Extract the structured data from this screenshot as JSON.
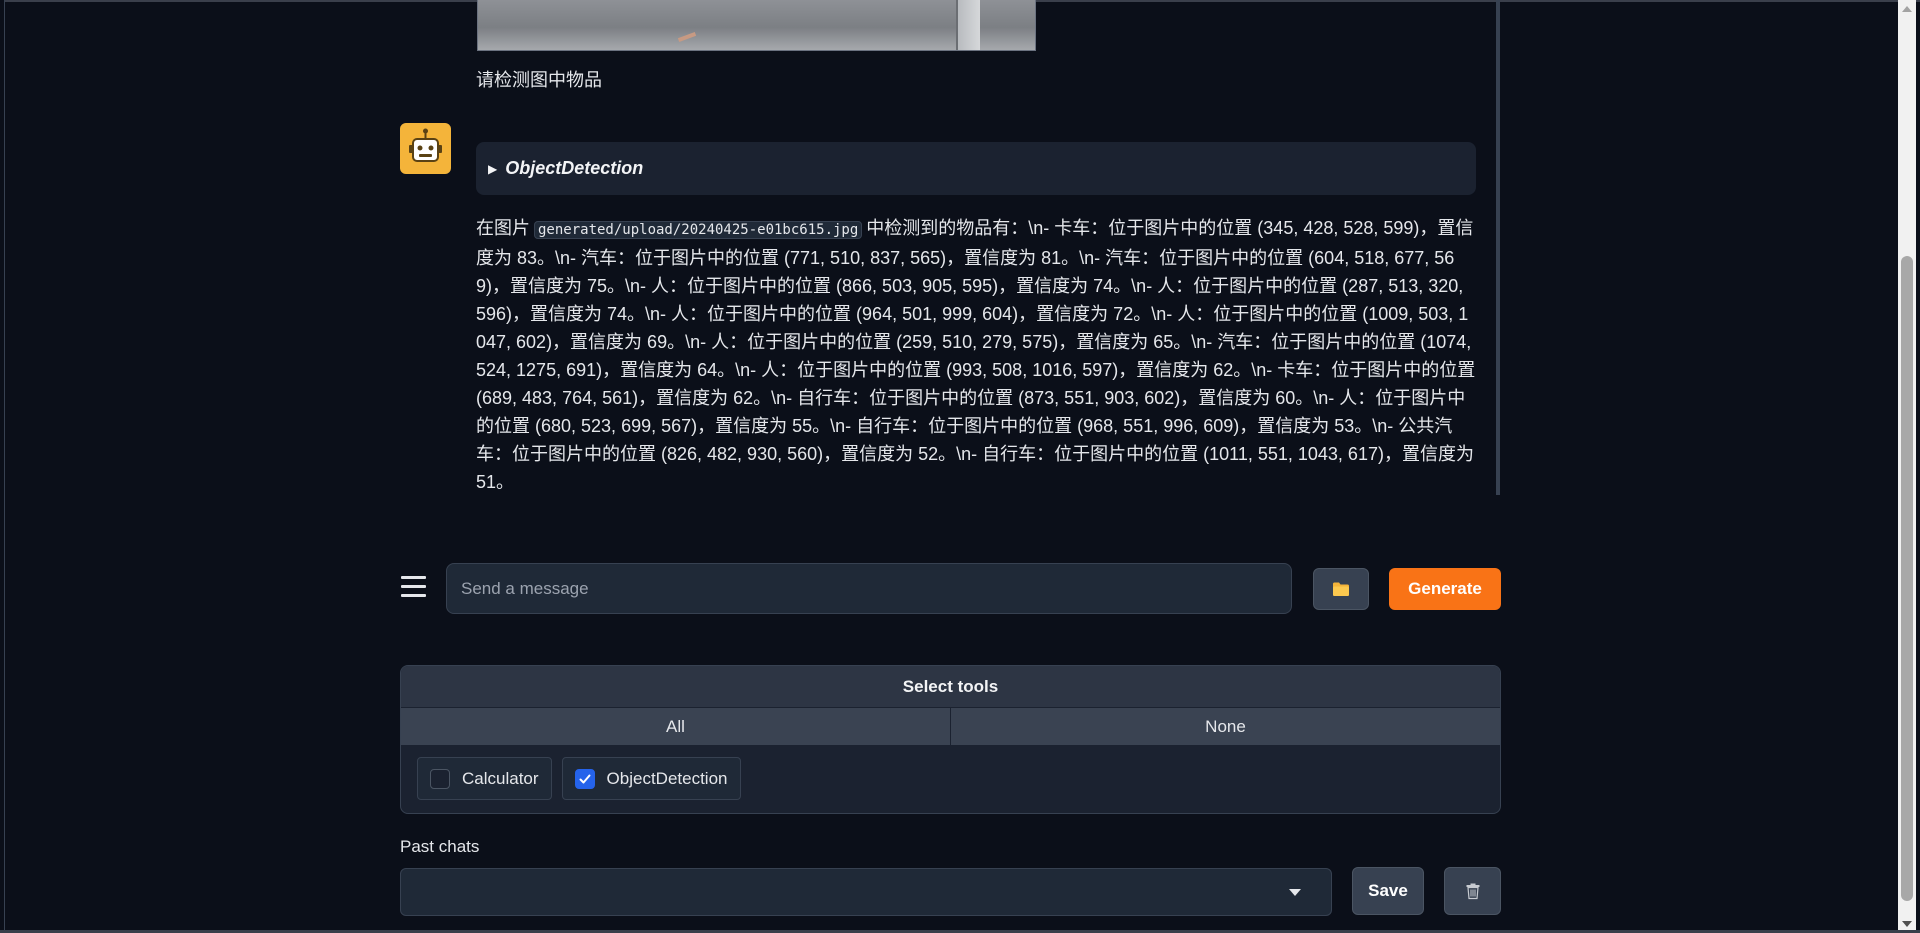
{
  "chat": {
    "user_message": "请检测图中物品",
    "tool_call_name": "ObjectDetection",
    "bot_message_before": "在图片",
    "bot_message_code": "generated/upload/20240425-e01bc615.jpg",
    "bot_message_after": "中检测到的物品有：\\n- 卡车：位于图片中的位置 (345, 428, 528, 599)，置信度为 83。\\n- 汽车：位于图片中的位置 (771, 510, 837, 565)，置信度为 81。\\n- 汽车：位于图片中的位置 (604, 518, 677, 569)，置信度为 75。\\n- 人：位于图片中的位置 (866, 503, 905, 595)，置信度为 74。\\n- 人：位于图片中的位置 (287, 513, 320, 596)，置信度为 74。\\n- 人：位于图片中的位置 (964, 501, 999, 604)，置信度为 72。\\n- 人：位于图片中的位置 (1009, 503, 1047, 602)，置信度为 69。\\n- 人：位于图片中的位置 (259, 510, 279, 575)，置信度为 65。\\n- 汽车：位于图片中的位置 (1074, 524, 1275, 691)，置信度为 64。\\n- 人：位于图片中的位置 (993, 508, 1016, 597)，置信度为 62。\\n- 卡车：位于图片中的位置 (689, 483, 764, 561)，置信度为 62。\\n- 自行车：位于图片中的位置 (873, 551, 903, 602)，置信度为 60。\\n- 人：位于图片中的位置 (680, 523, 699, 567)，置信度为 55。\\n- 自行车：位于图片中的位置 (968, 551, 996, 609)，置信度为 53。\\n- 公共汽车：位于图片中的位置 (826, 482, 930, 560)，置信度为 52。\\n- 自行车：位于图片中的位置 (1011, 551, 1043, 617)，置信度为 51。"
  },
  "input": {
    "placeholder": "Send a message",
    "value": "",
    "generate_label": "Generate"
  },
  "tools": {
    "header": "Select tools",
    "tab_all": "All",
    "tab_none": "None",
    "options": [
      {
        "label": "Calculator",
        "checked": false
      },
      {
        "label": "ObjectDetection",
        "checked": true
      }
    ]
  },
  "past_chats": {
    "label": "Past chats",
    "selected": "",
    "save_label": "Save"
  },
  "colors": {
    "background": "#0b0f19",
    "accent": "#f97316",
    "avatar": "#f4b43a",
    "checkbox_checked": "#2563eb"
  },
  "icons": {
    "avatar": "robot-icon",
    "menu": "hamburger-menu-icon",
    "upload": "folder-icon",
    "delete": "trash-icon",
    "dropdown": "chevron-down-icon"
  }
}
